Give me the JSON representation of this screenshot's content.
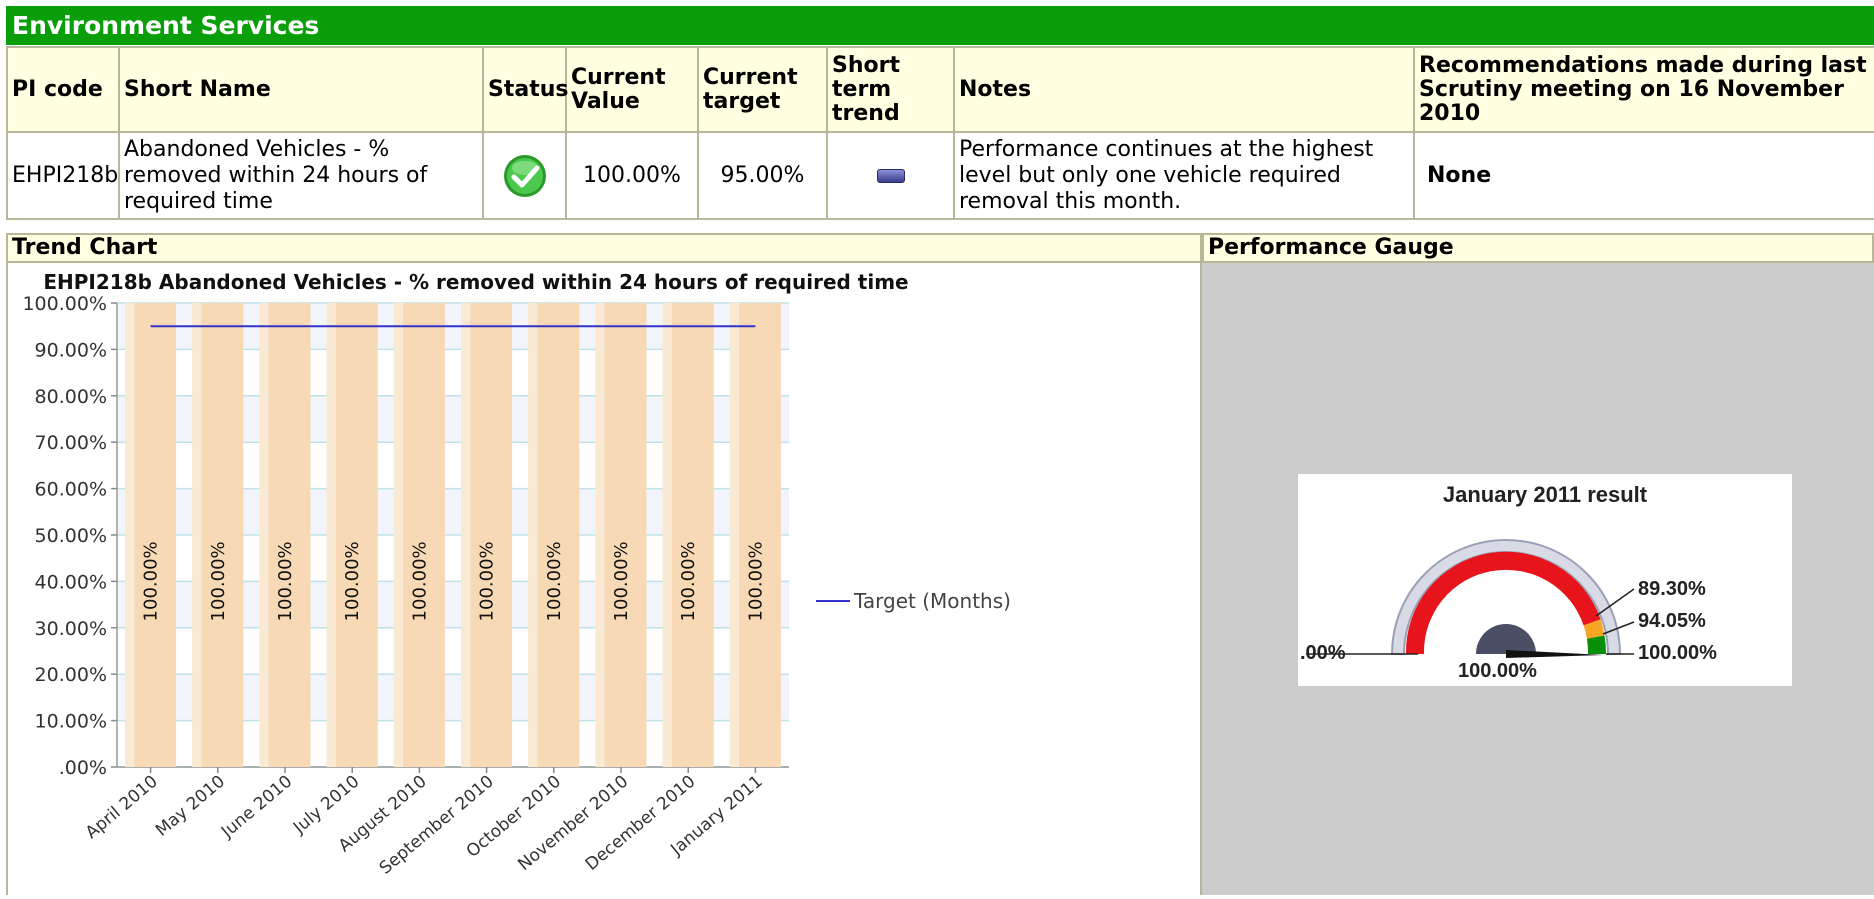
{
  "section": {
    "title": "Environment Services"
  },
  "table": {
    "headers": {
      "pi_code": "PI code",
      "short_name": "Short Name",
      "status": "Status",
      "current_value": "Current Value",
      "current_target": "Current target",
      "short_term_trend": "Short term trend",
      "notes": "Notes",
      "recommendations": "Recommendations made during last Scrutiny meeting on 16 November 2010"
    },
    "row": {
      "pi_code": "EHPI218b",
      "short_name": "Abandoned Vehicles - % removed within 24 hours of required time",
      "status_icon": "green-check-icon",
      "current_value": "100.00%",
      "current_target": "95.00%",
      "trend_icon": "no-change-bar-icon",
      "notes": "Performance continues at the highest level but only one vehicle required removal this month.",
      "recommendations": "None"
    }
  },
  "trend_chart": {
    "heading": "Trend Chart"
  },
  "gauge": {
    "heading": "Performance Gauge",
    "title": "January 2011 result",
    "labels": {
      "left": ".00%",
      "bottom": "100.00%",
      "mark1": "89.30%",
      "mark2": "94.05%",
      "mark3": "100.00%"
    },
    "value": 100,
    "colors": {
      "red": "#e8141b",
      "amber": "#f5a623",
      "green": "#0a8f0a"
    }
  },
  "chart_data": {
    "type": "bar",
    "title": "EHPI218b Abandoned Vehicles - % removed within 24 hours of required time",
    "categories": [
      "April 2010",
      "May 2010",
      "June 2010",
      "July 2010",
      "August 2010",
      "September 2010",
      "October 2010",
      "November 2010",
      "December 2010",
      "January 2011"
    ],
    "series": [
      {
        "values": [
          100,
          100,
          100,
          100,
          100,
          100,
          100,
          100,
          100,
          100
        ],
        "data_labels": [
          "100.00%",
          "100.00%",
          "100.00%",
          "100.00%",
          "100.00%",
          "100.00%",
          "100.00%",
          "100.00%",
          "100.00%",
          "100.00%"
        ]
      },
      {
        "name": "Target (Months)",
        "type": "line",
        "values": [
          95,
          95,
          95,
          95,
          95,
          95,
          95,
          95,
          95,
          95
        ]
      }
    ],
    "yticks": [
      "100.00%",
      "90.00%",
      "80.00%",
      "70.00%",
      "60.00%",
      "50.00%",
      "40.00%",
      "30.00%",
      "20.00%",
      "10.00%",
      ".00%"
    ],
    "ylim": [
      0,
      100
    ],
    "grid": true,
    "legend": "right",
    "colors": {
      "bar": "#f7dab5",
      "target": "#3333cc"
    }
  }
}
